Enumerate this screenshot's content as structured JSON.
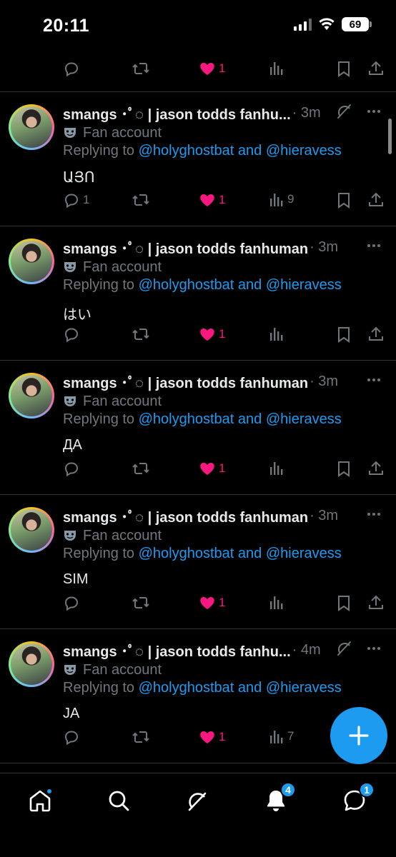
{
  "status_bar": {
    "time": "20:11",
    "battery": "69"
  },
  "top_residual_text": "..",
  "top_actions": {
    "like_count": "1"
  },
  "tweets": [
    {
      "name": "smangs ･ﾟ◌ | jason todds fanhu...",
      "time": "· 3m",
      "label": "Fan account",
      "replying_prefix": "Replying to ",
      "mention1": "@holyghostbat",
      "and_word": " and ",
      "mention2": "@hieravess",
      "text": "ԱՅՈ",
      "reply_count": "1",
      "like_count": "1",
      "view_count": "9",
      "grok": true
    },
    {
      "name": "smangs ･ﾟ◌ | jason todds fanhuman",
      "time": "· 3m",
      "label": "Fan account",
      "replying_prefix": "Replying to ",
      "mention1": "@holyghostbat",
      "and_word": " and ",
      "mention2": "@hieravess",
      "text": "はい",
      "reply_count": "",
      "like_count": "1",
      "view_count": "",
      "grok": false
    },
    {
      "name": "smangs ･ﾟ◌ | jason todds fanhuman",
      "time": "· 3m",
      "label": "Fan account",
      "replying_prefix": "Replying to ",
      "mention1": "@holyghostbat",
      "and_word": " and ",
      "mention2": "@hieravess",
      "text": "ДА",
      "reply_count": "",
      "like_count": "1",
      "view_count": "",
      "grok": false
    },
    {
      "name": "smangs ･ﾟ◌ | jason todds fanhuman",
      "time": "· 3m",
      "label": "Fan account",
      "replying_prefix": "Replying to ",
      "mention1": "@holyghostbat",
      "and_word": " and ",
      "mention2": "@hieravess",
      "text": "SIM",
      "reply_count": "",
      "like_count": "1",
      "view_count": "",
      "grok": false
    },
    {
      "name": "smangs ･ﾟ◌ | jason todds fanhu...",
      "time": "· 4m",
      "label": "Fan account",
      "replying_prefix": "Replying to ",
      "mention1": "@holyghostbat",
      "and_word": " and ",
      "mention2": "@hieravess",
      "text": "JA",
      "reply_count": "",
      "like_count": "1",
      "view_count": "7",
      "grok": true
    }
  ],
  "nav": {
    "notifications_badge": "4",
    "messages_badge": "1"
  },
  "colors": {
    "accent": "#1d9bf0",
    "like": "#f91880",
    "muted": "#71767b",
    "divider": "#2f3336"
  },
  "icons": [
    "reply-icon",
    "retweet-icon",
    "heart-icon",
    "views-icon",
    "bookmark-icon",
    "share-icon",
    "grok-icon",
    "more-icon",
    "mask-icon",
    "home-icon",
    "search-icon",
    "notifications-icon",
    "messages-icon",
    "compose-icon"
  ]
}
